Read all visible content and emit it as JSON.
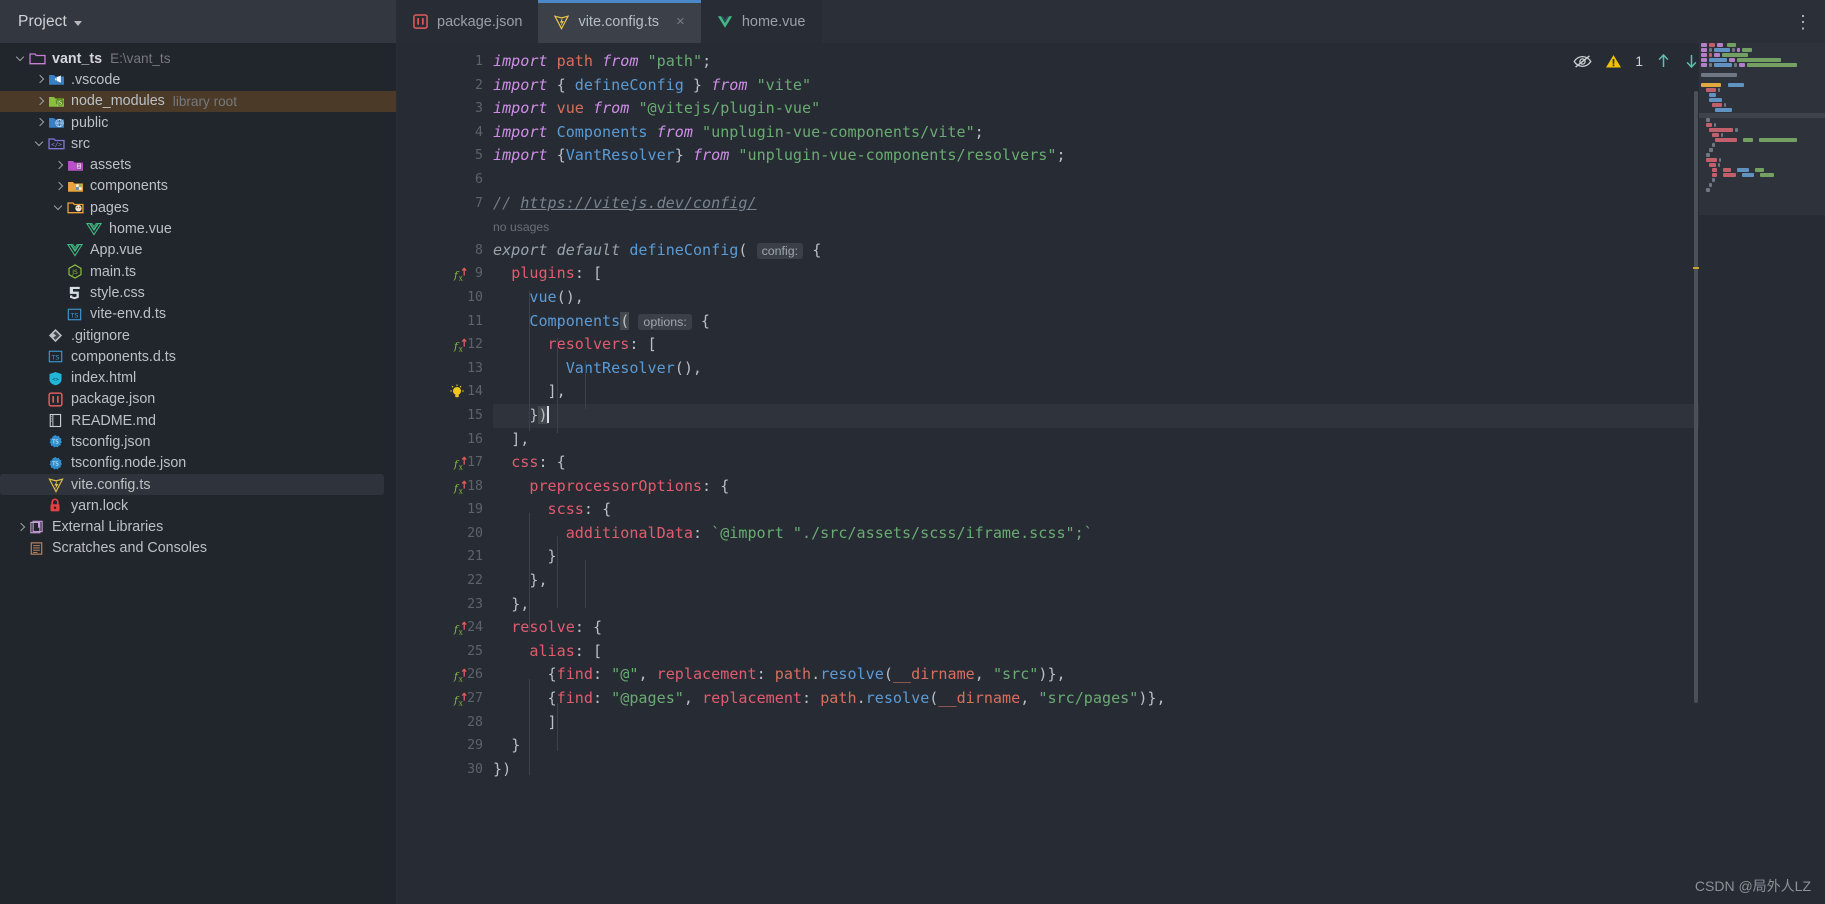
{
  "window": {
    "project_panel_title": "Project",
    "watermark": "CSDN @局外人LZ"
  },
  "tabs": [
    {
      "label": "package.json",
      "icon": "npm-icon",
      "active": false,
      "closable": false
    },
    {
      "label": "vite.config.ts",
      "icon": "vite-icon",
      "active": true,
      "closable": true,
      "close_glyph": "×"
    },
    {
      "label": "home.vue",
      "icon": "vue-icon",
      "active": false,
      "closable": false
    }
  ],
  "more_menu_glyph": "⋮",
  "sidebar": {
    "items": [
      {
        "label": "vant_ts",
        "sub": "E:\\vant_ts",
        "indent": 0,
        "arrow": "down",
        "icon": "folder-root-icon",
        "bold": true,
        "state": "normal"
      },
      {
        "label": ".vscode",
        "sub": "",
        "indent": 1,
        "arrow": "right",
        "icon": "vscode-folder-icon",
        "bold": false,
        "state": "normal"
      },
      {
        "label": "node_modules",
        "sub": "library root",
        "indent": 1,
        "arrow": "right",
        "icon": "node-modules-icon",
        "bold": false,
        "state": "selected-inactive"
      },
      {
        "label": "public",
        "sub": "",
        "indent": 1,
        "arrow": "right",
        "icon": "public-folder-icon",
        "bold": false,
        "state": "normal"
      },
      {
        "label": "src",
        "sub": "",
        "indent": 1,
        "arrow": "down",
        "icon": "src-folder-icon",
        "bold": false,
        "state": "normal"
      },
      {
        "label": "assets",
        "sub": "",
        "indent": 2,
        "arrow": "right",
        "icon": "assets-folder-icon",
        "bold": false,
        "state": "normal"
      },
      {
        "label": "components",
        "sub": "",
        "indent": 2,
        "arrow": "right",
        "icon": "components-folder-icon",
        "bold": false,
        "state": "normal"
      },
      {
        "label": "pages",
        "sub": "",
        "indent": 2,
        "arrow": "down",
        "icon": "pages-folder-icon",
        "bold": false,
        "state": "normal"
      },
      {
        "label": "home.vue",
        "sub": "",
        "indent": 3,
        "arrow": "none",
        "icon": "vue-icon",
        "bold": false,
        "state": "normal"
      },
      {
        "label": "App.vue",
        "sub": "",
        "indent": 2,
        "arrow": "none",
        "icon": "vue-icon",
        "bold": false,
        "state": "normal"
      },
      {
        "label": "main.ts",
        "sub": "",
        "indent": 2,
        "arrow": "none",
        "icon": "js-icon",
        "bold": false,
        "state": "normal"
      },
      {
        "label": "style.css",
        "sub": "",
        "indent": 2,
        "arrow": "none",
        "icon": "css-icon",
        "bold": false,
        "state": "normal"
      },
      {
        "label": "vite-env.d.ts",
        "sub": "",
        "indent": 2,
        "arrow": "none",
        "icon": "ts-icon",
        "bold": false,
        "state": "normal"
      },
      {
        "label": ".gitignore",
        "sub": "",
        "indent": 1,
        "arrow": "none",
        "icon": "git-icon",
        "bold": false,
        "state": "normal"
      },
      {
        "label": "components.d.ts",
        "sub": "",
        "indent": 1,
        "arrow": "none",
        "icon": "ts-icon",
        "bold": false,
        "state": "normal"
      },
      {
        "label": "index.html",
        "sub": "",
        "indent": 1,
        "arrow": "none",
        "icon": "html-icon",
        "bold": false,
        "state": "normal"
      },
      {
        "label": "package.json",
        "sub": "",
        "indent": 1,
        "arrow": "none",
        "icon": "npm-icon",
        "bold": false,
        "state": "normal"
      },
      {
        "label": "README.md",
        "sub": "",
        "indent": 1,
        "arrow": "none",
        "icon": "markdown-icon",
        "bold": false,
        "state": "normal"
      },
      {
        "label": "tsconfig.json",
        "sub": "",
        "indent": 1,
        "arrow": "none",
        "icon": "tsconfig-icon",
        "bold": false,
        "state": "normal"
      },
      {
        "label": "tsconfig.node.json",
        "sub": "",
        "indent": 1,
        "arrow": "none",
        "icon": "tsconfig-icon",
        "bold": false,
        "state": "normal"
      },
      {
        "label": "vite.config.ts",
        "sub": "",
        "indent": 1,
        "arrow": "none",
        "icon": "vite-icon",
        "bold": false,
        "state": "selected"
      },
      {
        "label": "yarn.lock",
        "sub": "",
        "indent": 1,
        "arrow": "none",
        "icon": "lock-icon",
        "bold": false,
        "state": "normal"
      },
      {
        "label": "External Libraries",
        "sub": "",
        "indent": 0,
        "arrow": "right",
        "icon": "libraries-icon",
        "bold": false,
        "state": "normal"
      },
      {
        "label": "Scratches and Consoles",
        "sub": "",
        "indent": 0,
        "arrow": "none",
        "icon": "scratches-icon",
        "bold": false,
        "state": "normal"
      }
    ]
  },
  "editor": {
    "file": "vite.config.ts",
    "current_line": 15,
    "inline_hints": [
      {
        "after_line": 7,
        "text": "no usages"
      }
    ],
    "parameter_hints": [
      "config:",
      "options:"
    ],
    "inspection_widget": {
      "eye_icon": "inspections-off-icon",
      "warning_icon": "warning-triangle-icon",
      "warning_count": "1",
      "prev_icon": "arrow-up-icon",
      "next_icon": "arrow-down-icon"
    },
    "gutter_icons": {
      "fx_lines": [
        9,
        12,
        17,
        18,
        24,
        26,
        27
      ],
      "bulb_lines": [
        14
      ]
    },
    "lines": [
      {
        "n": 1,
        "text": "import path from \"path\";"
      },
      {
        "n": 2,
        "text": "import { defineConfig } from \"vite\""
      },
      {
        "n": 3,
        "text": "import vue from \"@vitejs/plugin-vue\""
      },
      {
        "n": 4,
        "text": "import Components from \"unplugin-vue-components/vite\";"
      },
      {
        "n": 5,
        "text": "import {VantResolver} from \"unplugin-vue-components/resolvers\";"
      },
      {
        "n": 6,
        "text": ""
      },
      {
        "n": 7,
        "text": "// https://vitejs.dev/config/"
      },
      {
        "n": 8,
        "text": "export default defineConfig( config: {"
      },
      {
        "n": 9,
        "text": "  plugins: ["
      },
      {
        "n": 10,
        "text": "    vue(),"
      },
      {
        "n": 11,
        "text": "    Components( options: {"
      },
      {
        "n": 12,
        "text": "      resolvers: ["
      },
      {
        "n": 13,
        "text": "        VantResolver(),"
      },
      {
        "n": 14,
        "text": "      ],"
      },
      {
        "n": 15,
        "text": "    })"
      },
      {
        "n": 16,
        "text": "  ],"
      },
      {
        "n": 17,
        "text": "  css: {"
      },
      {
        "n": 18,
        "text": "    preprocessorOptions: {"
      },
      {
        "n": 19,
        "text": "      scss: {"
      },
      {
        "n": 20,
        "text": "        additionalData: `@import \"./src/assets/scss/iframe.scss\";`"
      },
      {
        "n": 21,
        "text": "      }"
      },
      {
        "n": 22,
        "text": "    },"
      },
      {
        "n": 23,
        "text": "  },"
      },
      {
        "n": 24,
        "text": "  resolve: {"
      },
      {
        "n": 25,
        "text": "    alias: ["
      },
      {
        "n": 26,
        "text": "      {find: \"@\", replacement: path.resolve(__dirname, \"src\")},"
      },
      {
        "n": 27,
        "text": "      {find: \"@pages\", replacement: path.resolve(__dirname, \"src/pages\")},"
      },
      {
        "n": 28,
        "text": "      ]"
      },
      {
        "n": 29,
        "text": "  }"
      },
      {
        "n": 30,
        "text": "})"
      }
    ]
  },
  "colors": {
    "bg_editor": "#272b33",
    "bg_sidebar": "#21252c",
    "bg_topbar": "#2f343c",
    "tab_active": "#3c4149",
    "tab_underline": "#4a88c7",
    "keyword": "#cf8ee8",
    "string": "#6aab73",
    "property": "#e05c6e",
    "function": "#5b9bd5",
    "comment": "#737a84",
    "warning": "#f2c200",
    "selected_row": "#4a3a27"
  }
}
